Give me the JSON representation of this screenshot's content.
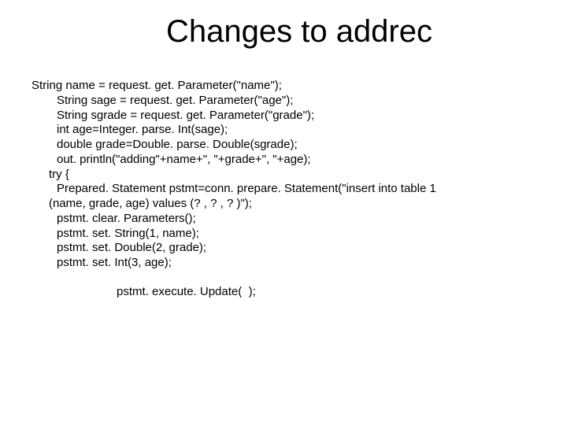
{
  "title": "Changes to addrec",
  "code": [
    "String name = request. get. Parameter(\"name\");",
    "String sage = request. get. Parameter(\"age\");",
    "String sgrade = request. get. Parameter(\"grade\");",
    "int age=Integer. parse. Int(sage);",
    "double grade=Double. parse. Double(sgrade);",
    "out. println(\"adding\"+name+\", \"+grade+\", \"+age);",
    "try {",
    "Prepared. Statement pstmt=conn. prepare. Statement(\"insert into table 1",
    "(name, grade, age) values (? , ? , ? )\");",
    "pstmt. clear. Parameters();",
    "pstmt. set. String(1, name);",
    "pstmt. set. Double(2, grade);",
    "pstmt. set. Int(3, age);",
    "pstmt. execute. Update(  );"
  ]
}
